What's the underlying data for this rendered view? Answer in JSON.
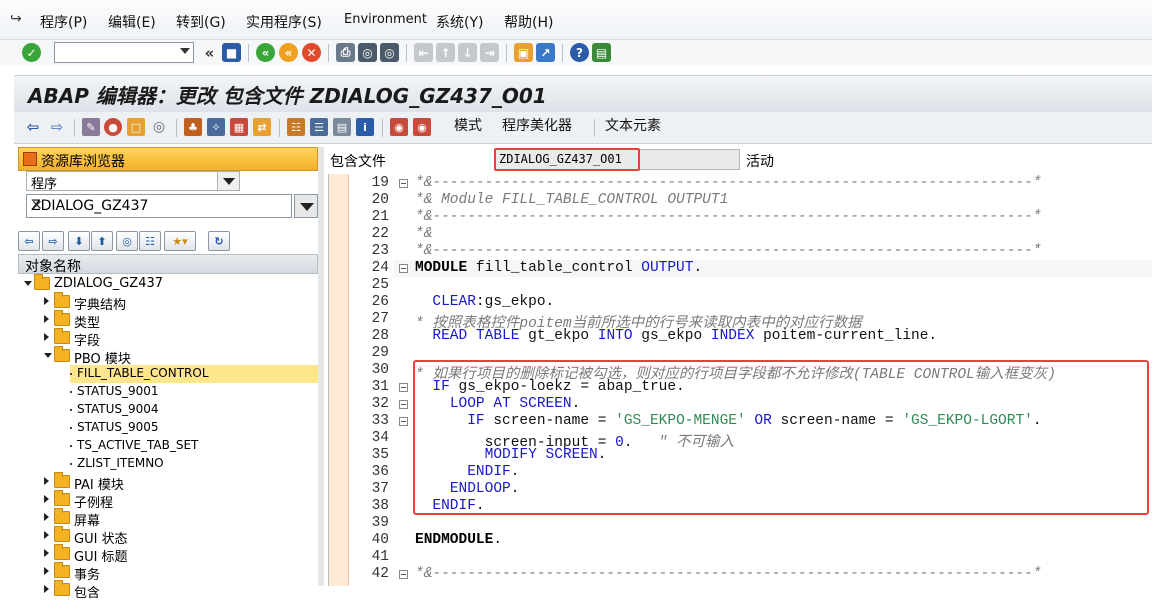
{
  "menubar": {
    "items": [
      "程序(P)",
      "编辑(E)",
      "转到(G)",
      "实用程序(S)",
      "Environment",
      "系统(Y)",
      "帮助(H)"
    ]
  },
  "toolbar": {
    "command_value": "",
    "icons": [
      "check-icon",
      "back-icon",
      "save-icon",
      "back-green-icon",
      "exit-icon",
      "cancel-icon",
      "print-icon",
      "find-icon",
      "find-next-icon",
      "first-page-icon",
      "prev-page-icon",
      "next-page-icon",
      "last-page-icon",
      "new-session-icon",
      "shortcut-icon",
      "help-icon",
      "customize-icon"
    ]
  },
  "title": "ABAP 编辑器：更改 包含文件 ZDIALOG_GZ437_O01",
  "app_toolbar": {
    "mode_label": "模式",
    "pretty_printer_label": "程序美化器",
    "text_elements_label": "文本元素"
  },
  "navigator": {
    "header": "资源库浏览器",
    "object_type": "程序",
    "object_name": "ZDIALOG_GZ437",
    "tree_header": "对象名称",
    "tree": [
      {
        "label": "ZDIALOG_GZ437",
        "level": 0,
        "type": "folder",
        "expanded": true
      },
      {
        "label": "字典结构",
        "level": 1,
        "type": "folder",
        "expanded": false
      },
      {
        "label": "类型",
        "level": 1,
        "type": "folder",
        "expanded": false
      },
      {
        "label": "字段",
        "level": 1,
        "type": "folder",
        "expanded": false
      },
      {
        "label": "PBO 模块",
        "level": 1,
        "type": "folder",
        "expanded": true
      },
      {
        "label": "FILL_TABLE_CONTROL",
        "level": 2,
        "type": "leaf",
        "selected": true
      },
      {
        "label": "STATUS_9001",
        "level": 2,
        "type": "leaf"
      },
      {
        "label": "STATUS_9004",
        "level": 2,
        "type": "leaf"
      },
      {
        "label": "STATUS_9005",
        "level": 2,
        "type": "leaf"
      },
      {
        "label": "TS_ACTIVE_TAB_SET",
        "level": 2,
        "type": "leaf"
      },
      {
        "label": "ZLIST_ITEMNO",
        "level": 2,
        "type": "leaf"
      },
      {
        "label": "PAI 模块",
        "level": 1,
        "type": "folder",
        "expanded": false
      },
      {
        "label": "子例程",
        "level": 1,
        "type": "folder",
        "expanded": false
      },
      {
        "label": "屏幕",
        "level": 1,
        "type": "folder",
        "expanded": false
      },
      {
        "label": "GUI 状态",
        "level": 1,
        "type": "folder",
        "expanded": false
      },
      {
        "label": "GUI 标题",
        "level": 1,
        "type": "folder",
        "expanded": false
      },
      {
        "label": "事务",
        "level": 1,
        "type": "folder",
        "expanded": false
      },
      {
        "label": "包含",
        "level": 1,
        "type": "folder",
        "expanded": false
      }
    ]
  },
  "editor": {
    "include_label": "包含文件",
    "include_name": "ZDIALOG_GZ437_O01",
    "status": "活动",
    "lines": [
      {
        "n": "19",
        "fold": true,
        "tokens": [
          [
            "c",
            "*&---------------------------------------------------------------------*"
          ]
        ]
      },
      {
        "n": "20",
        "tokens": [
          [
            "c",
            "*& Module FILL_TABLE_CONTROL OUTPUT1"
          ]
        ]
      },
      {
        "n": "21",
        "tokens": [
          [
            "c",
            "*&---------------------------------------------------------------------*"
          ]
        ]
      },
      {
        "n": "22",
        "tokens": [
          [
            "c",
            "*&"
          ]
        ]
      },
      {
        "n": "23",
        "tokens": [
          [
            "c",
            "*&---------------------------------------------------------------------*"
          ]
        ]
      },
      {
        "n": "24",
        "fold": true,
        "tokens": [
          [
            "b",
            "MODULE"
          ],
          [
            "p",
            " fill_table_control "
          ],
          [
            "k",
            "OUTPUT"
          ],
          [
            "p",
            "."
          ]
        ]
      },
      {
        "n": "25",
        "tokens": []
      },
      {
        "n": "26",
        "tokens": [
          [
            "p",
            "  "
          ],
          [
            "k",
            "CLEAR"
          ],
          [
            "p",
            ":gs_ekpo."
          ]
        ]
      },
      {
        "n": "27",
        "tokens": [
          [
            "c",
            "* 按照表格控件poitem当前所选中的行号来读取内表中的对应行数据"
          ]
        ]
      },
      {
        "n": "28",
        "tokens": [
          [
            "p",
            "  "
          ],
          [
            "k",
            "READ TABLE"
          ],
          [
            "p",
            " gt_ekpo "
          ],
          [
            "k",
            "INTO"
          ],
          [
            "p",
            " gs_ekpo "
          ],
          [
            "k",
            "INDEX"
          ],
          [
            "p",
            " poitem-current_line."
          ]
        ]
      },
      {
        "n": "29",
        "tokens": []
      },
      {
        "n": "30",
        "tokens": [
          [
            "c",
            "* 如果行项目的删除标记被勾选，则对应的行项目字段都不允许修改(TABLE CONTROL输入框变灰)"
          ]
        ]
      },
      {
        "n": "31",
        "fold": true,
        "tokens": [
          [
            "p",
            "  "
          ],
          [
            "k",
            "IF"
          ],
          [
            "p",
            " gs_ekpo-loekz = abap_true."
          ]
        ]
      },
      {
        "n": "32",
        "fold": true,
        "tokens": [
          [
            "p",
            "    "
          ],
          [
            "k",
            "LOOP AT SCREEN"
          ],
          [
            "p",
            "."
          ]
        ]
      },
      {
        "n": "33",
        "fold": true,
        "tokens": [
          [
            "p",
            "      "
          ],
          [
            "k",
            "IF"
          ],
          [
            "p",
            " screen-name = "
          ],
          [
            "s",
            "'GS_EKPO-MENGE'"
          ],
          [
            "p",
            " "
          ],
          [
            "k",
            "OR"
          ],
          [
            "p",
            " screen-name = "
          ],
          [
            "s",
            "'GS_EKPO-LGORT'"
          ],
          [
            "p",
            "."
          ]
        ]
      },
      {
        "n": "34",
        "tokens": [
          [
            "p",
            "        screen-input = "
          ],
          [
            "n",
            "0"
          ],
          [
            "p",
            ".   "
          ],
          [
            "c",
            "\" 不可输入"
          ]
        ]
      },
      {
        "n": "35",
        "tokens": [
          [
            "p",
            "        "
          ],
          [
            "k",
            "MODIFY SCREEN"
          ],
          [
            "p",
            "."
          ]
        ]
      },
      {
        "n": "36",
        "tokens": [
          [
            "p",
            "      "
          ],
          [
            "k",
            "ENDIF"
          ],
          [
            "p",
            "."
          ]
        ]
      },
      {
        "n": "37",
        "tokens": [
          [
            "p",
            "    "
          ],
          [
            "k",
            "ENDLOOP"
          ],
          [
            "p",
            "."
          ]
        ]
      },
      {
        "n": "38",
        "tokens": [
          [
            "p",
            "  "
          ],
          [
            "k",
            "ENDIF"
          ],
          [
            "p",
            "."
          ]
        ]
      },
      {
        "n": "39",
        "tokens": []
      },
      {
        "n": "40",
        "tokens": [
          [
            "b",
            "ENDMODULE"
          ],
          [
            "p",
            "."
          ]
        ]
      },
      {
        "n": "41",
        "tokens": []
      },
      {
        "n": "42",
        "fold": true,
        "tokens": [
          [
            "c",
            "*&---------------------------------------------------------------------*"
          ]
        ]
      }
    ]
  }
}
